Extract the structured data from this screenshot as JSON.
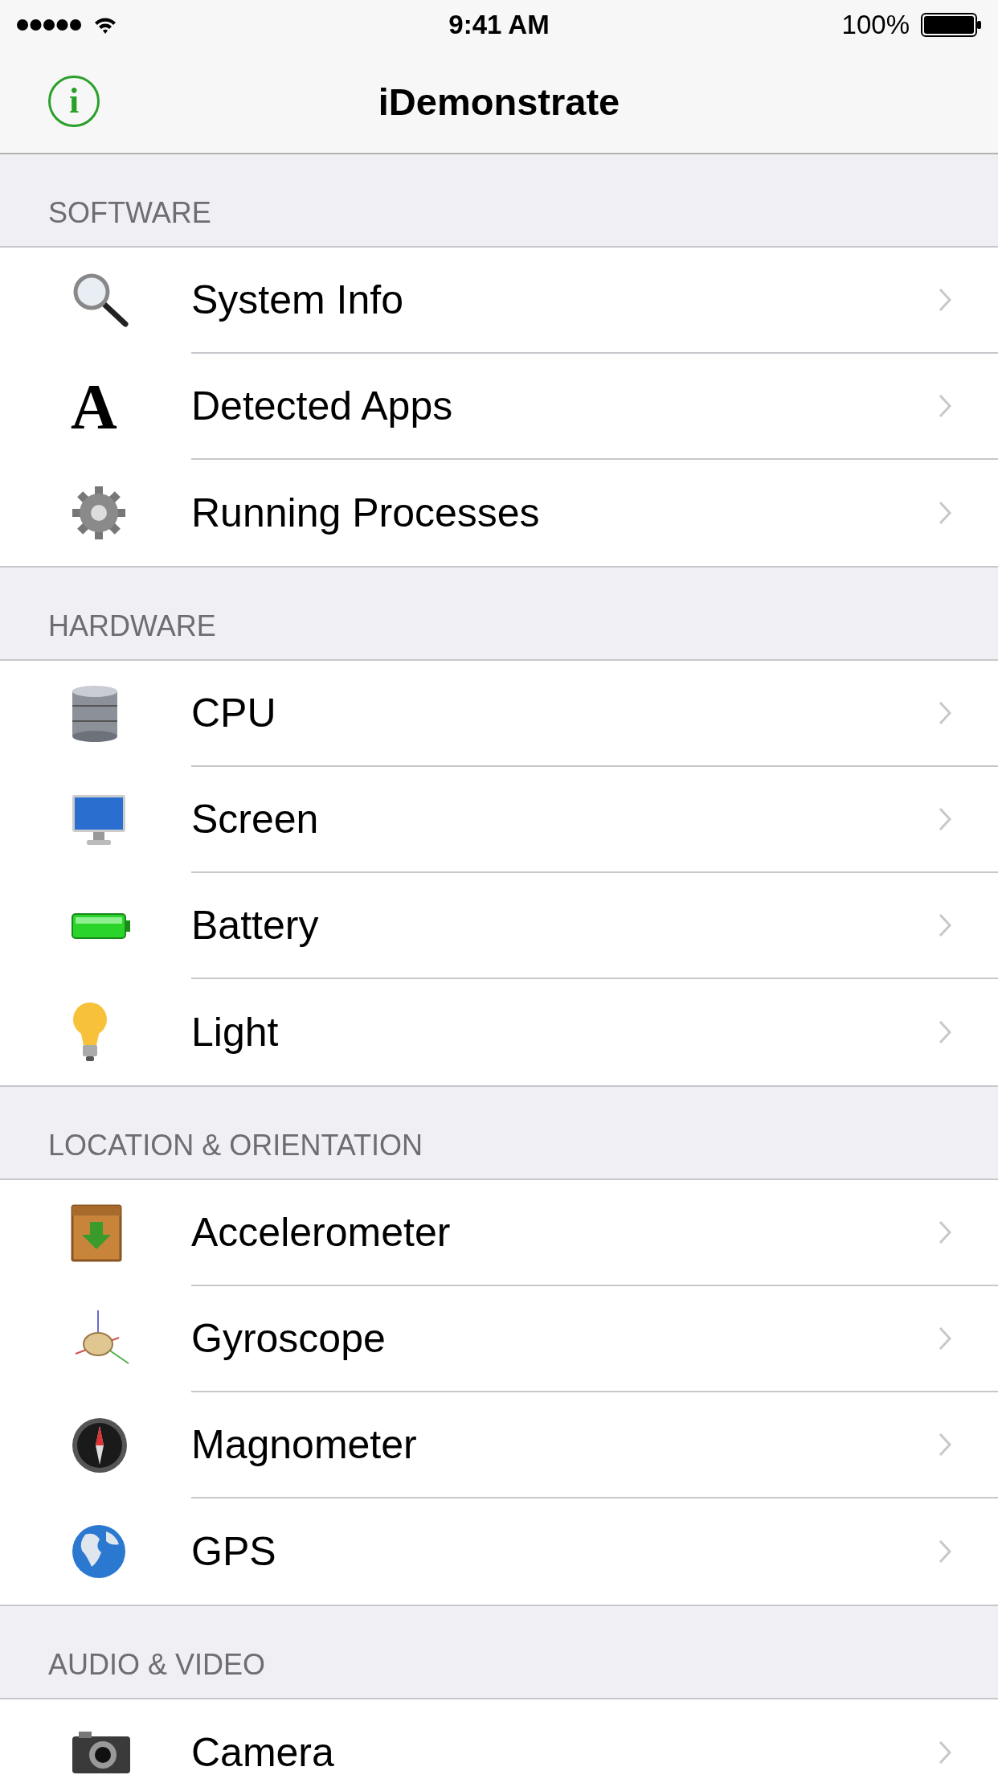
{
  "status_bar": {
    "time": "9:41 AM",
    "battery": "100%"
  },
  "nav": {
    "info_glyph": "i",
    "title": "iDemonstrate"
  },
  "sections": [
    {
      "title": "SOFTWARE",
      "items": [
        {
          "label": "System Info"
        },
        {
          "label": "Detected Apps",
          "icon_text": "A"
        },
        {
          "label": "Running Processes"
        }
      ]
    },
    {
      "title": "HARDWARE",
      "items": [
        {
          "label": "CPU"
        },
        {
          "label": "Screen"
        },
        {
          "label": "Battery"
        },
        {
          "label": "Light"
        }
      ]
    },
    {
      "title": "LOCATION & ORIENTATION",
      "items": [
        {
          "label": "Accelerometer"
        },
        {
          "label": "Gyroscope"
        },
        {
          "label": "Magnometer"
        },
        {
          "label": "GPS"
        }
      ]
    },
    {
      "title": "AUDIO & VIDEO",
      "items": [
        {
          "label": "Camera"
        }
      ]
    }
  ]
}
